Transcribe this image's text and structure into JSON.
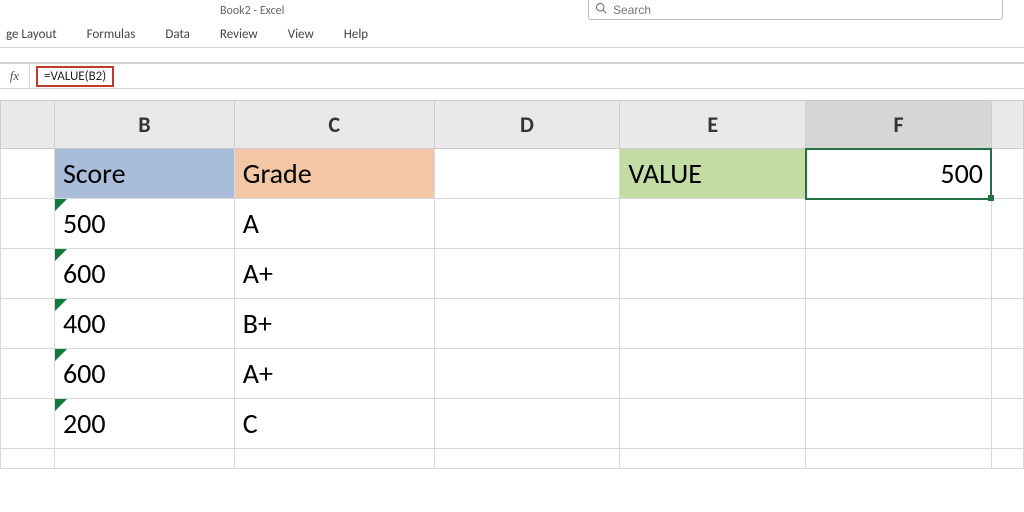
{
  "title": "Book2  -  Excel",
  "search": {
    "placeholder": "Search"
  },
  "ribbon": {
    "tabs": [
      "ge Layout",
      "Formulas",
      "Data",
      "Review",
      "View",
      "Help"
    ]
  },
  "formula_bar": {
    "fx": "fx",
    "value": "=VALUE(B2)"
  },
  "columns": [
    "B",
    "C",
    "D",
    "E",
    "F"
  ],
  "active_cell": "F1",
  "sheet": {
    "B1": "Score",
    "C1": "Grade",
    "E1": "VALUE",
    "F1": "500",
    "B2": "500",
    "C2": "A",
    "B3": "600",
    "C3": "A+",
    "B4": "400",
    "C4": "B+",
    "B5": "600",
    "C5": "A+",
    "B6": "200",
    "C6": "C"
  }
}
